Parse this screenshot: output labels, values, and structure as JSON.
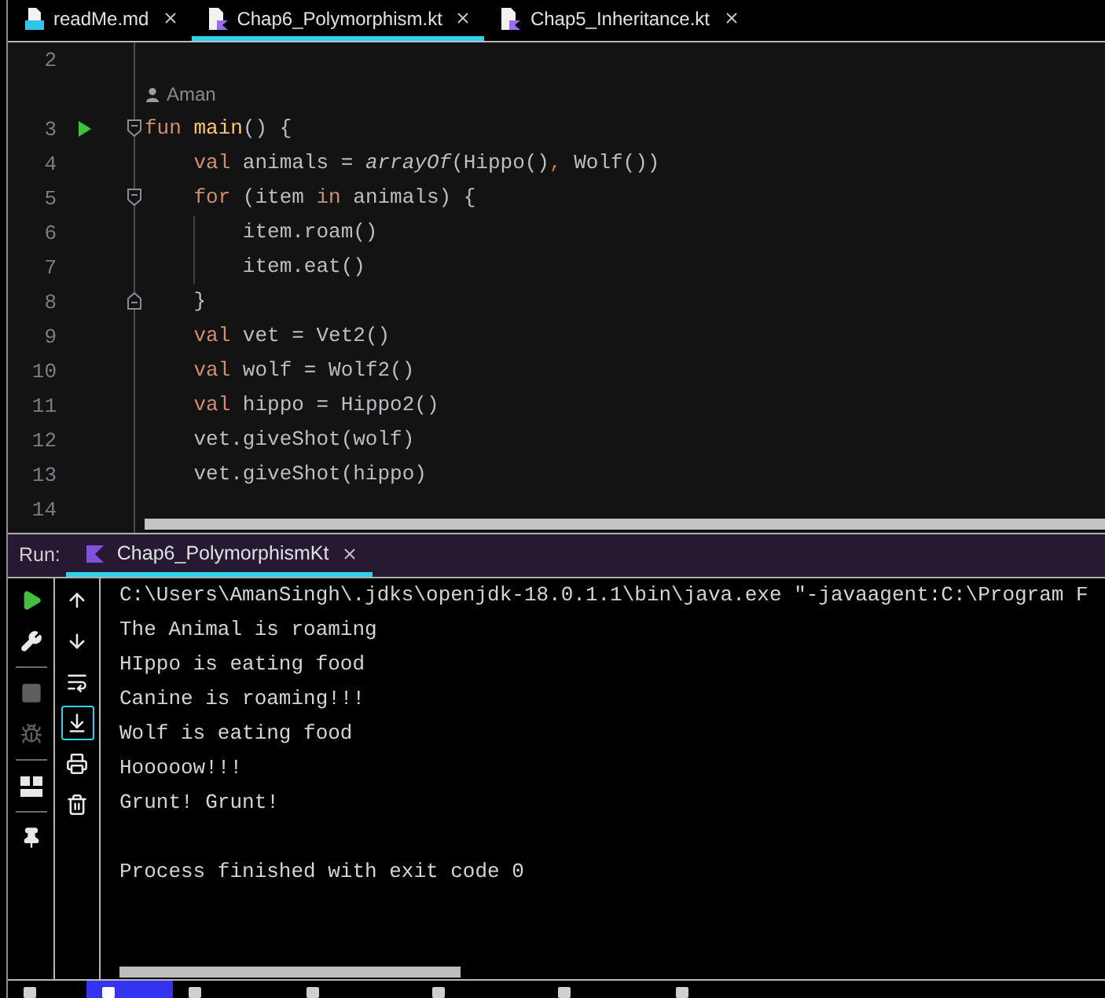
{
  "tabs": [
    {
      "label": "readMe.md",
      "kind": "markdown",
      "selected": false
    },
    {
      "label": "Chap6_Polymorphism.kt",
      "kind": "kotlin",
      "selected": true
    },
    {
      "label": "Chap5_Inheritance.kt",
      "kind": "kotlin",
      "selected": false
    }
  ],
  "editor": {
    "lines": [
      {
        "kind": "code",
        "number": "2"
      },
      {
        "kind": "author",
        "author": "Aman"
      },
      {
        "kind": "code",
        "number": "3",
        "markers": [
          {
            "kind": "run"
          },
          {
            "kind": "fold_start"
          }
        ],
        "tokens": [
          {
            "text": "fun ",
            "kind": "keyword"
          },
          {
            "text": "main",
            "kind": "declaration"
          },
          {
            "text": "() {",
            "kind": "plain"
          }
        ]
      },
      {
        "kind": "code",
        "number": "4",
        "tokens": [
          {
            "text": "    val",
            "kind": "keyword"
          },
          {
            "text": " animals = ",
            "kind": "plain"
          },
          {
            "text": "arrayOf",
            "kind": "italic"
          },
          {
            "text": "(Hippo()",
            "kind": "plain"
          },
          {
            "text": ",",
            "kind": "comma"
          },
          {
            "text": " Wolf())",
            "kind": "plain"
          }
        ]
      },
      {
        "kind": "code",
        "number": "5",
        "markers": [
          {
            "kind": "fold_start"
          }
        ],
        "tokens": [
          {
            "text": "    for",
            "kind": "keyword"
          },
          {
            "text": " (item ",
            "kind": "plain"
          },
          {
            "text": "in",
            "kind": "keyword"
          },
          {
            "text": " animals) {",
            "kind": "plain"
          }
        ]
      },
      {
        "kind": "code",
        "number": "6",
        "markers": [
          {
            "kind": "indent_guide"
          }
        ],
        "tokens": [
          {
            "text": "        item.roam()",
            "kind": "plain"
          }
        ]
      },
      {
        "kind": "code",
        "number": "7",
        "markers": [
          {
            "kind": "indent_guide"
          }
        ],
        "tokens": [
          {
            "text": "        item.eat()",
            "kind": "plain"
          }
        ]
      },
      {
        "kind": "code",
        "number": "8",
        "markers": [
          {
            "kind": "fold_end"
          }
        ],
        "tokens": [
          {
            "text": "    }",
            "kind": "plain"
          }
        ]
      },
      {
        "kind": "code",
        "number": "9",
        "tokens": [
          {
            "text": "    val",
            "kind": "keyword"
          },
          {
            "text": " vet = Vet2()",
            "kind": "plain"
          }
        ]
      },
      {
        "kind": "code",
        "number": "10",
        "tokens": [
          {
            "text": "    val",
            "kind": "keyword"
          },
          {
            "text": " wolf = Wolf2()",
            "kind": "plain"
          }
        ]
      },
      {
        "kind": "code",
        "number": "11",
        "tokens": [
          {
            "text": "    val",
            "kind": "keyword"
          },
          {
            "text": " hippo = Hippo2()",
            "kind": "plain"
          }
        ]
      },
      {
        "kind": "code",
        "number": "12",
        "tokens": [
          {
            "text": "    vet.giveShot(wolf)",
            "kind": "plain"
          }
        ]
      },
      {
        "kind": "code",
        "number": "13",
        "tokens": [
          {
            "text": "    vet.giveShot(hippo)",
            "kind": "plain"
          }
        ]
      },
      {
        "kind": "code",
        "number": "14"
      }
    ]
  },
  "run_panel": {
    "label": "Run:",
    "tabs": [
      {
        "label": "Chap6_PolymorphismKt",
        "selected": true
      }
    ],
    "toolbar_left": [
      {
        "kind": "run",
        "disabled": false
      },
      {
        "kind": "build",
        "disabled": false
      },
      {
        "kind": "separator"
      },
      {
        "kind": "stop",
        "disabled": true
      },
      {
        "kind": "debug",
        "disabled": true
      },
      {
        "kind": "separator"
      },
      {
        "kind": "layout",
        "disabled": false
      },
      {
        "kind": "separator"
      },
      {
        "kind": "pin",
        "disabled": false
      }
    ],
    "toolbar_right": [
      {
        "kind": "up",
        "on": false
      },
      {
        "kind": "down",
        "on": false
      },
      {
        "kind": "wrap",
        "on": false
      },
      {
        "kind": "scroll_end",
        "on": true
      },
      {
        "kind": "print",
        "on": false
      },
      {
        "kind": "clear",
        "on": false
      }
    ],
    "output": [
      {
        "kind": "text",
        "text": "C:\\Users\\AmanSingh\\.jdks\\openjdk-18.0.1.1\\bin\\java.exe \"-javaagent:C:\\Program F"
      },
      {
        "kind": "text",
        "text": "The Animal is roaming"
      },
      {
        "kind": "text",
        "text": "HIppo is eating food"
      },
      {
        "kind": "text",
        "text": "Canine is roaming!!!"
      },
      {
        "kind": "text",
        "text": "Wolf is eating food"
      },
      {
        "kind": "text",
        "text": "Hooooow!!!"
      },
      {
        "kind": "text",
        "text": "Grunt! Grunt!"
      },
      {
        "kind": "blank"
      },
      {
        "kind": "text",
        "text": "Process finished with exit code 0"
      }
    ]
  },
  "bottom_bar": {
    "tabs": [
      {
        "selected": false
      },
      {
        "selected": true
      },
      {
        "selected": false
      },
      {
        "selected": false
      },
      {
        "selected": false
      },
      {
        "selected": false
      },
      {
        "selected": false
      }
    ]
  }
}
